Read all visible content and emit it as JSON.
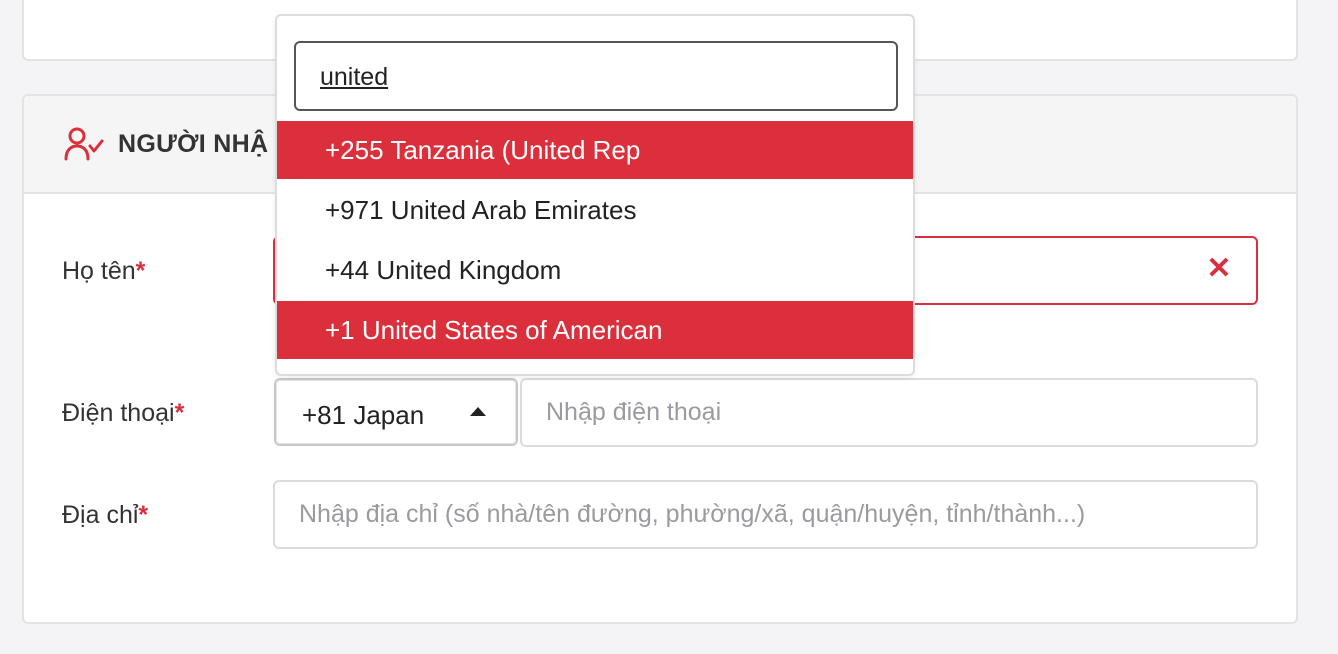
{
  "section": {
    "title": "NGƯỜI NHẬ",
    "icon": "user-check-icon"
  },
  "form": {
    "name": {
      "label": "Họ tên",
      "required_mark": "*",
      "clear_icon": "close-icon",
      "clear_glyph": "✕"
    },
    "phone": {
      "label": "Điện thoại",
      "required_mark": "*",
      "country_value": "+81 Japan",
      "placeholder": "Nhập điện thoại"
    },
    "address": {
      "label": "Địa chỉ",
      "required_mark": "*",
      "placeholder": "Nhập địa chỉ (số nhà/tên đường, phường/xã, quận/huyện, tỉnh/thành...)"
    }
  },
  "country_dropdown": {
    "search_value": "united",
    "options": [
      {
        "label": "+255 Tanzania (United Rep",
        "highlighted": true
      },
      {
        "label": "+971 United Arab Emirates",
        "highlighted": false
      },
      {
        "label": "+44 United Kingdom",
        "highlighted": false
      },
      {
        "label": "+1 United States of American",
        "highlighted": true
      }
    ]
  },
  "colors": {
    "accent": "#db2f3c",
    "error_border": "#d8303f"
  }
}
